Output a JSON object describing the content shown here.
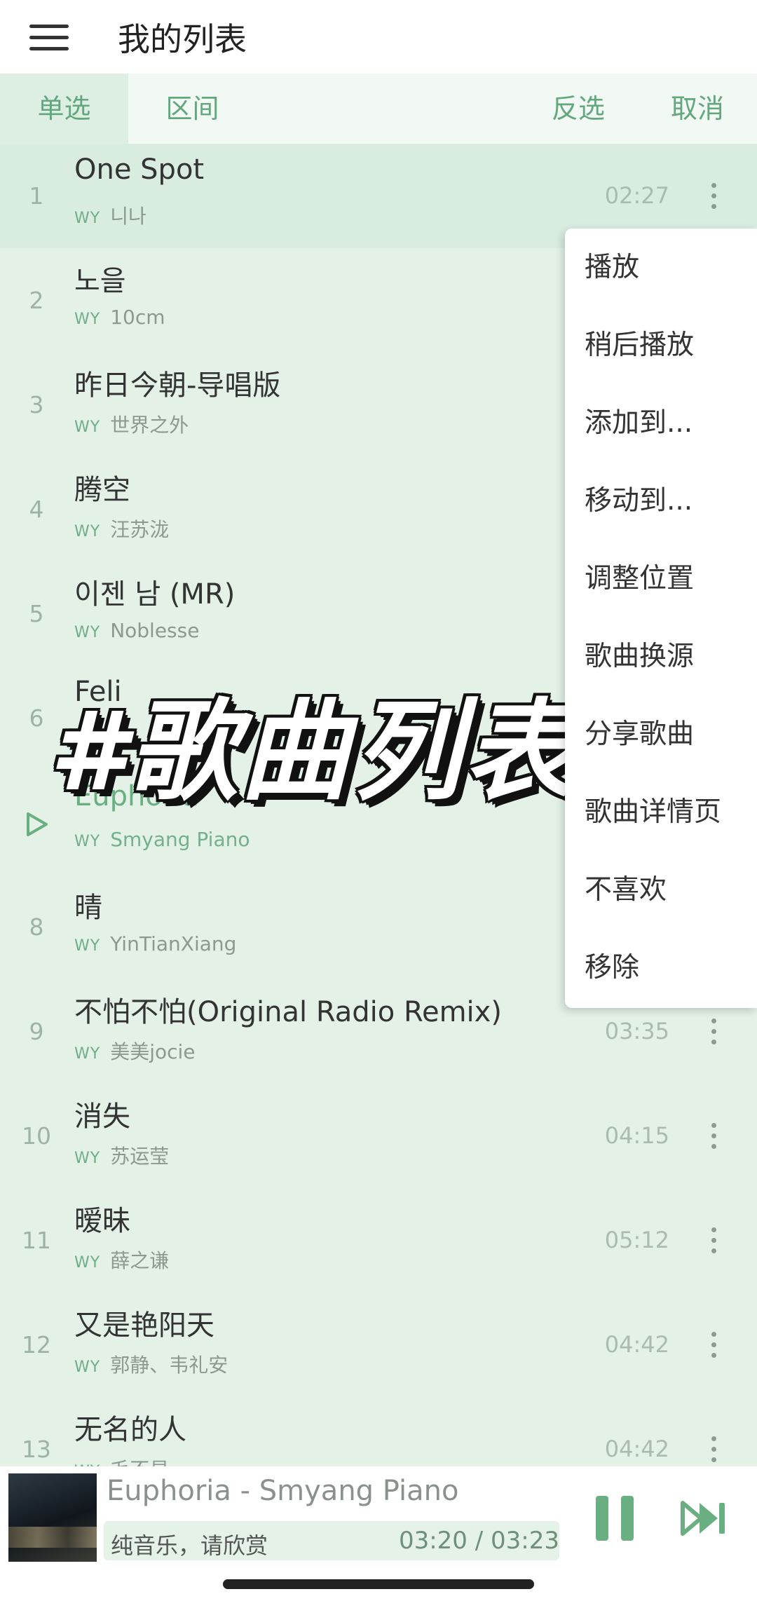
{
  "header": {
    "title": "我的列表",
    "menu_icon": "hamburger-menu-icon"
  },
  "toolbar": {
    "single": "单选",
    "range": "区间",
    "invert": "反选",
    "cancel": "取消"
  },
  "songs": [
    {
      "num": "1",
      "title": "One Spot",
      "source": "WY",
      "artist": "니나",
      "duration": "02:27"
    },
    {
      "num": "2",
      "title": "노을",
      "source": "WY",
      "artist": "10cm",
      "duration": ""
    },
    {
      "num": "3",
      "title": "昨日今朝-导唱版",
      "source": "WY",
      "artist": "世界之外",
      "duration": ""
    },
    {
      "num": "4",
      "title": "腾空",
      "source": "WY",
      "artist": "汪苏泷",
      "duration": ""
    },
    {
      "num": "5",
      "title": "이젠 남 (MR)",
      "source": "WY",
      "artist": "Noblesse",
      "duration": ""
    },
    {
      "num": "6",
      "title": "Feli",
      "source": "WY",
      "artist": "",
      "duration": ""
    },
    {
      "num": "",
      "title": "Euphoria",
      "source": "WY",
      "artist": "Smyang Piano",
      "duration": "",
      "playing": true
    },
    {
      "num": "8",
      "title": "晴",
      "source": "WY",
      "artist": "YinTianXiang",
      "duration": ""
    },
    {
      "num": "9",
      "title": "不怕不怕(Original Radio Remix)",
      "source": "WY",
      "artist": "美美jocie",
      "duration": "03:35"
    },
    {
      "num": "10",
      "title": "消失",
      "source": "WY",
      "artist": "苏运莹",
      "duration": "04:15"
    },
    {
      "num": "11",
      "title": "暧昧",
      "source": "WY",
      "artist": "薛之谦",
      "duration": "05:12"
    },
    {
      "num": "12",
      "title": "又是艳阳天",
      "source": "WY",
      "artist": "郭静、韦礼安",
      "duration": "04:42"
    },
    {
      "num": "13",
      "title": "无名的人",
      "source": "WY",
      "artist": "毛不易",
      "duration": "04:42"
    }
  ],
  "context_menu": [
    "播放",
    "稍后播放",
    "添加到...",
    "移动到...",
    "调整位置",
    "歌曲换源",
    "分享歌曲",
    "歌曲详情页",
    "不喜欢",
    "移除"
  ],
  "overlay": {
    "hashtag": "#歌曲列表"
  },
  "player": {
    "now_playing": "Euphoria - Smyang Piano",
    "lyric": "纯音乐，请欣赏",
    "time": "03:20 / 03:23"
  },
  "colors": {
    "accent": "#6aaf82",
    "list_bg": "#e3f1e7"
  }
}
